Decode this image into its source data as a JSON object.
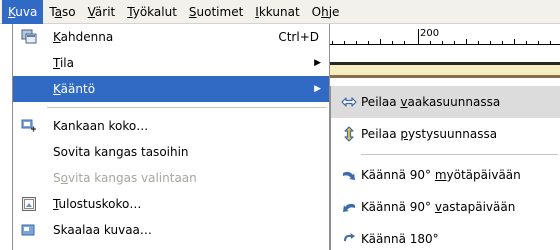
{
  "menubar": {
    "items": [
      {
        "pre": "",
        "mn": "K",
        "post": "uva"
      },
      {
        "pre": "T",
        "mn": "a",
        "post": "so"
      },
      {
        "pre": "",
        "mn": "V",
        "post": "ärit"
      },
      {
        "pre": "",
        "mn": "T",
        "post": "yökalut"
      },
      {
        "pre": "",
        "mn": "S",
        "post": "uotimet"
      },
      {
        "pre": "",
        "mn": "I",
        "post": "kkunat"
      },
      {
        "pre": "O",
        "mn": "h",
        "post": "je"
      }
    ]
  },
  "ruler": {
    "label": "200"
  },
  "menu": {
    "items": [
      {
        "pre": "",
        "mn": "K",
        "post": "ahdenna",
        "accel": "Ctrl+D",
        "icon": "duplicate-icon"
      },
      {
        "pre": "",
        "mn": "T",
        "post": "ila",
        "submenu": true
      },
      {
        "pre": "",
        "mn": "K",
        "post": "ääntö",
        "submenu": true
      },
      {
        "pre": "Kankaan koko",
        "mn": "",
        "post": "…",
        "icon": "canvas-size-icon"
      },
      {
        "pre": "Sovita kangas tasoihin",
        "mn": "",
        "post": ""
      },
      {
        "pre": "S",
        "mn": "o",
        "post": "vita kangas valintaan"
      },
      {
        "pre": "",
        "mn": "T",
        "post": "ulostuskoko…",
        "icon": "print-size-icon"
      },
      {
        "pre": "Skaalaa kuvaa…",
        "mn": "",
        "post": "",
        "icon": "scale-image-icon"
      }
    ]
  },
  "submenu": {
    "items": [
      {
        "pre": "Peilaa ",
        "mn": "v",
        "post": "aakasuunnassa",
        "icon": "flip-horizontal-icon"
      },
      {
        "pre": "Peilaa ",
        "mn": "p",
        "post": "ystysuunnassa",
        "icon": "flip-vertical-icon"
      },
      {
        "pre": "Käännä 90° ",
        "mn": "m",
        "post": "yötäpäivään",
        "icon": "rotate-cw-icon"
      },
      {
        "pre": "Käännä 90° ",
        "mn": "v",
        "post": "astapäivään",
        "icon": "rotate-ccw-icon"
      },
      {
        "pre": "Käännä 180°",
        "mn": "",
        "post": "",
        "icon": "rotate-180-icon"
      }
    ]
  },
  "colors": {
    "selection": "#316ac5",
    "menubar_bg": "#f2f1ec",
    "disabled_text": "#a8a69c"
  }
}
